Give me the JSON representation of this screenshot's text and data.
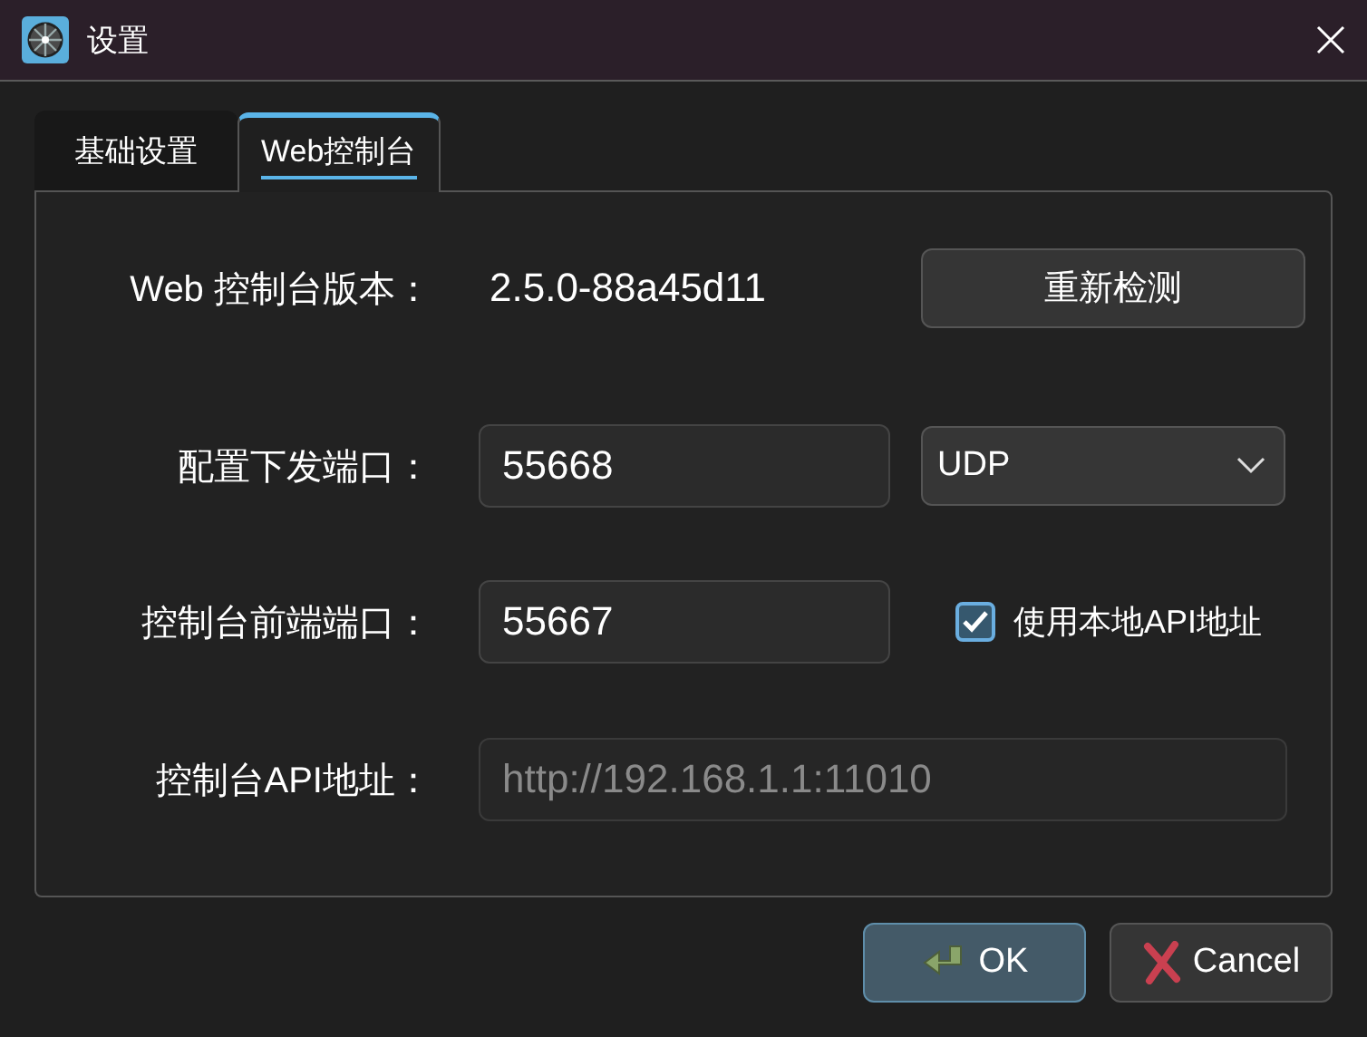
{
  "window": {
    "title": "设置"
  },
  "tabs": [
    {
      "label": "基础设置",
      "selected": false
    },
    {
      "label": "Web控制台",
      "selected": true
    }
  ],
  "version": {
    "label": "Web 控制台版本：",
    "value": "2.5.0-88a45d11",
    "button": "重新检测"
  },
  "config_port": {
    "label": "配置下发端口：",
    "value": "55668",
    "protocol": "UDP"
  },
  "frontend_port": {
    "label": "控制台前端端口：",
    "value": "55667",
    "use_local_api": {
      "label": "使用本地API地址",
      "checked": true
    }
  },
  "api_address": {
    "label": "控制台API地址：",
    "value": "http://192.168.1.1:11010",
    "disabled": true
  },
  "buttons": [
    {
      "label": "OK",
      "kind": "ok",
      "default": true
    },
    {
      "label": "Cancel",
      "kind": "cancel",
      "default": false
    }
  ]
}
